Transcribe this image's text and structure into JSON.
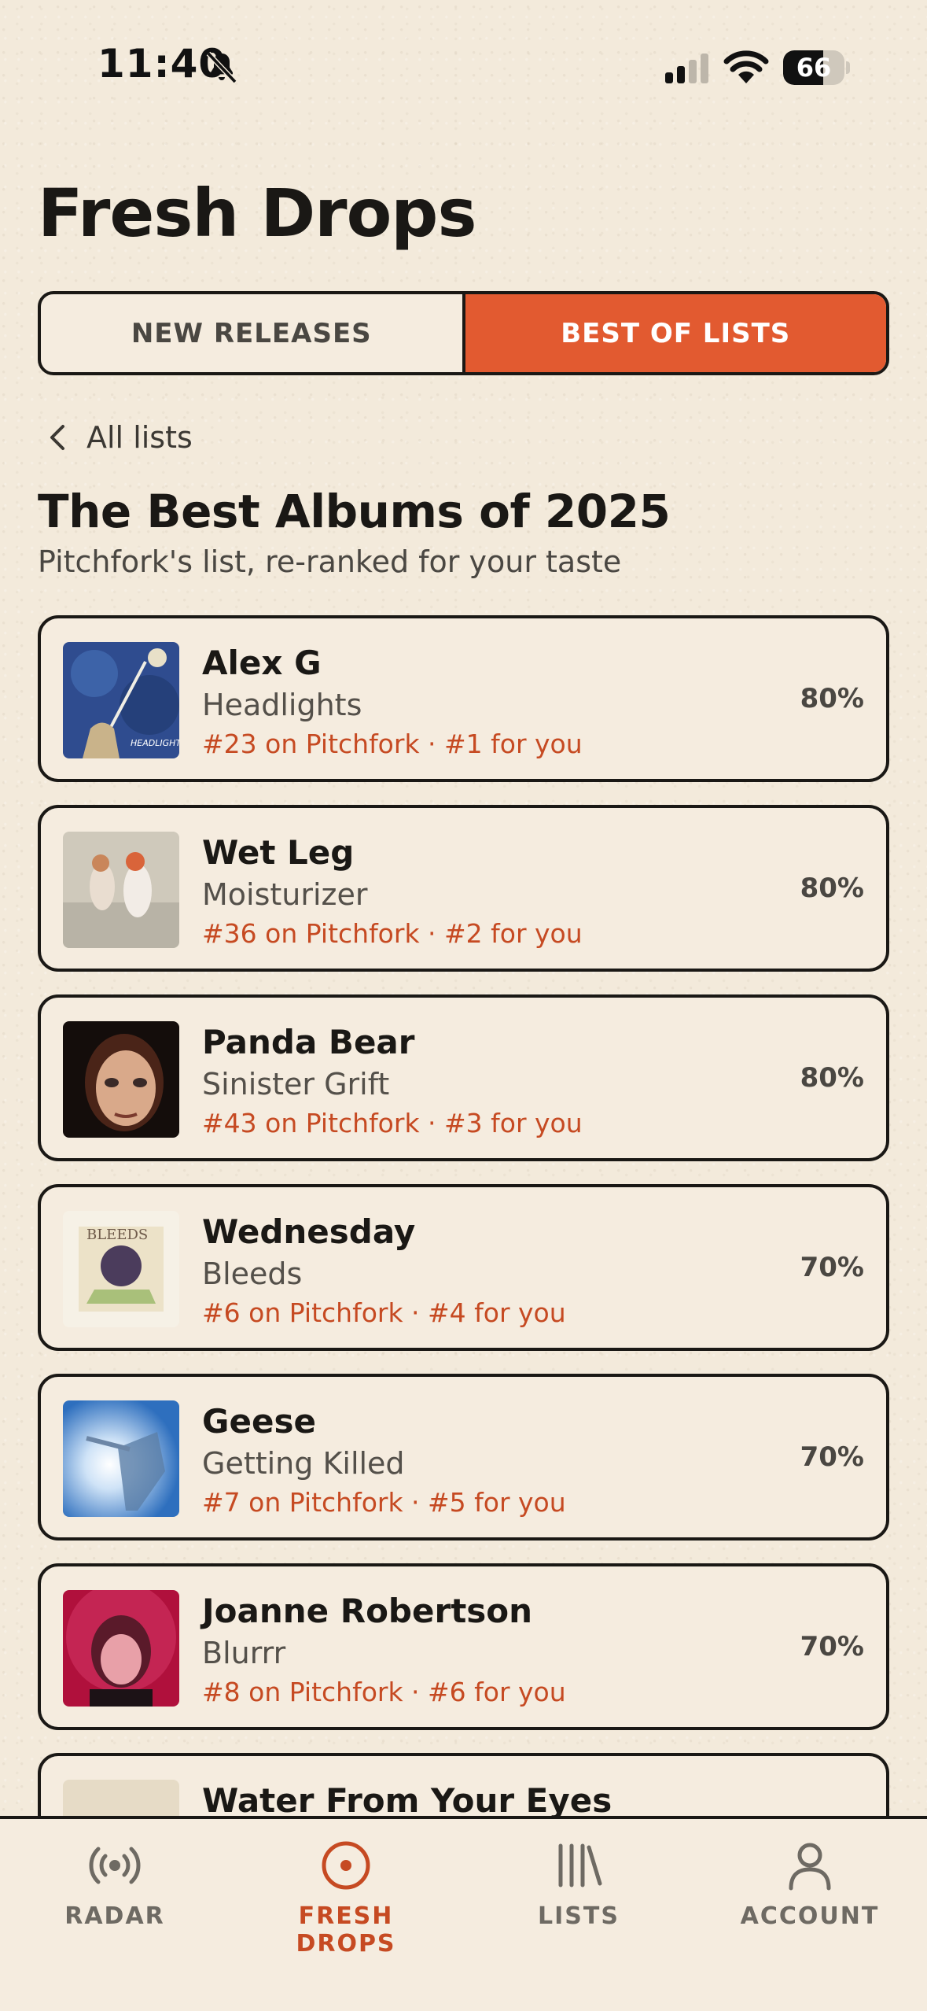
{
  "status_bar": {
    "time": "11:40",
    "battery": "66",
    "battery_level": 0.66
  },
  "header": {
    "title": "Fresh Drops"
  },
  "segments": [
    {
      "label": "NEW RELEASES",
      "active": false
    },
    {
      "label": "BEST OF LISTS",
      "active": true
    }
  ],
  "back_link": {
    "label": "All lists"
  },
  "list": {
    "title": "The Best Albums of 2025",
    "subtitle": "Pitchfork's list, re-ranked for your taste"
  },
  "albums": [
    {
      "artist": "Alex G",
      "album": "Headlights",
      "rank": "#23 on Pitchfork · #1 for you",
      "score": "80%"
    },
    {
      "artist": "Wet Leg",
      "album": "Moisturizer",
      "rank": "#36 on Pitchfork · #2 for you",
      "score": "80%"
    },
    {
      "artist": "Panda Bear",
      "album": "Sinister Grift",
      "rank": "#43 on Pitchfork · #3 for you",
      "score": "80%"
    },
    {
      "artist": "Wednesday",
      "album": "Bleeds",
      "rank": "#6 on Pitchfork · #4 for you",
      "score": "70%"
    },
    {
      "artist": "Geese",
      "album": "Getting Killed",
      "rank": "#7 on Pitchfork · #5 for you",
      "score": "70%"
    },
    {
      "artist": "Joanne Robertson",
      "album": "Blurrr",
      "rank": "#8 on Pitchfork · #6 for you",
      "score": "70%"
    },
    {
      "artist": "Water From Your Eyes",
      "album": "",
      "rank": "",
      "score": ""
    }
  ],
  "tab_bar": [
    {
      "label": "RADAR",
      "icon": "radar-icon",
      "active": false
    },
    {
      "label": "FRESH DROPS",
      "icon": "disc-icon",
      "active": true
    },
    {
      "label": "LISTS",
      "icon": "library-icon",
      "active": false
    },
    {
      "label": "ACCOUNT",
      "icon": "person-icon",
      "active": false
    }
  ],
  "colors": {
    "accent": "#e25a30",
    "accent_text": "#c64a22",
    "background": "#f3eadb",
    "ink": "#1a1815"
  }
}
